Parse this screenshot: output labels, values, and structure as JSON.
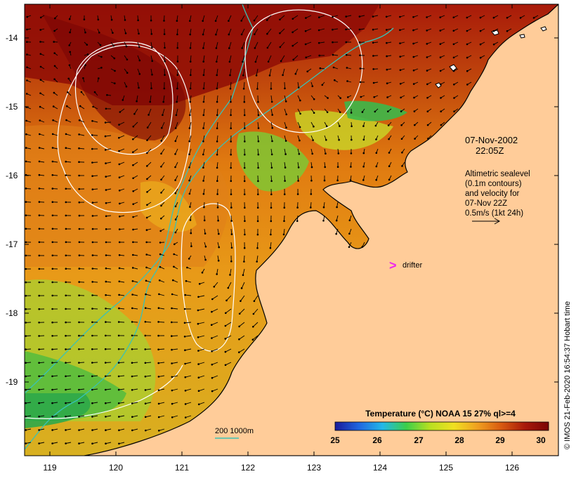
{
  "axes": {
    "y_labels": [
      "-14",
      "-15",
      "-16",
      "-17",
      "-18",
      "-19"
    ],
    "x_labels": [
      "119",
      "120",
      "121",
      "122",
      "123",
      "124",
      "125",
      "126"
    ]
  },
  "annotation": {
    "date": "07-Nov-2002",
    "time": "22:05Z",
    "lines": [
      "Altimetric sealevel",
      "(0.1m contours)",
      "and velocity for",
      "07-Nov 22Z",
      "0.5m/s (1kt 24h)"
    ]
  },
  "drifter": {
    "label": "drifter",
    "marker": ">"
  },
  "colorbar": {
    "title": "Temperature (°C) NOAA 15 27% ql>=4",
    "ticks": [
      "25",
      "26",
      "27",
      "28",
      "29",
      "30"
    ],
    "stops": [
      "#1a1a9a",
      "#1f66e0",
      "#22b8e8",
      "#3ccf4a",
      "#b8e020",
      "#f0e020",
      "#f0a020",
      "#d85a10",
      "#a81a0a",
      "#7a0505"
    ]
  },
  "bathymetry_legend": {
    "label": "200  1000m"
  },
  "credit": "© IMOS 21-Feb-2020 16:54:37 Hobart time",
  "colors": {
    "land": "#ffcc99",
    "isobath": "#39c2b6",
    "contour": "#ffffff",
    "drifter": "#ee22ee"
  }
}
